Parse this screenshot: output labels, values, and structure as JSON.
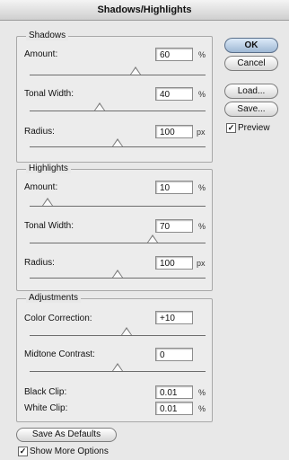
{
  "dialog": {
    "title": "Shadows/Highlights"
  },
  "shadows": {
    "legend": "Shadows",
    "amount": {
      "label": "Amount:",
      "value": "60",
      "unit": "%",
      "slider": 0.6
    },
    "tonal_width": {
      "label": "Tonal Width:",
      "value": "40",
      "unit": "%",
      "slider": 0.4
    },
    "radius": {
      "label": "Radius:",
      "value": "100",
      "unit": "px",
      "slider": 0.5
    }
  },
  "highlights": {
    "legend": "Highlights",
    "amount": {
      "label": "Amount:",
      "value": "10",
      "unit": "%",
      "slider": 0.1
    },
    "tonal_width": {
      "label": "Tonal Width:",
      "value": "70",
      "unit": "%",
      "slider": 0.7
    },
    "radius": {
      "label": "Radius:",
      "value": "100",
      "unit": "px",
      "slider": 0.5
    }
  },
  "adjustments": {
    "legend": "Adjustments",
    "color_correction": {
      "label": "Color Correction:",
      "value": "+10",
      "slider": 0.55
    },
    "midtone_contrast": {
      "label": "Midtone Contrast:",
      "value": "0",
      "slider": 0.5
    },
    "black_clip": {
      "label": "Black Clip:",
      "value": "0.01",
      "unit": "%"
    },
    "white_clip": {
      "label": "White Clip:",
      "value": "0.01",
      "unit": "%"
    }
  },
  "buttons": {
    "ok": "OK",
    "cancel": "Cancel",
    "load": "Load...",
    "save": "Save..."
  },
  "preview": {
    "label": "Preview",
    "checked": true
  },
  "save_defaults": "Save As Defaults",
  "show_more": {
    "label": "Show More Options",
    "checked": true
  }
}
